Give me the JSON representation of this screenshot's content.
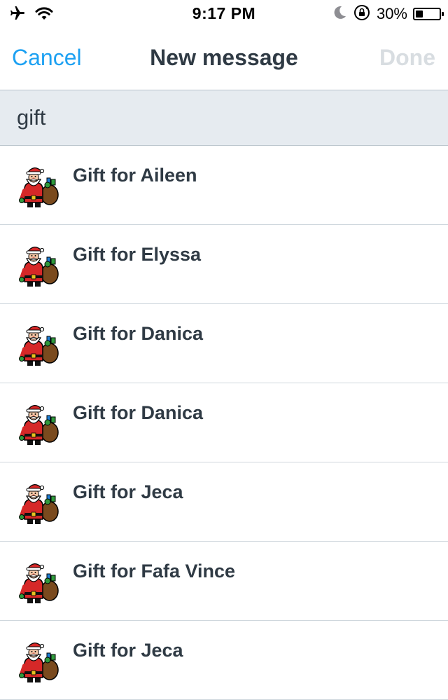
{
  "status_bar": {
    "time": "9:17 PM",
    "battery_percent": "30%",
    "battery_level": 0.3
  },
  "nav": {
    "cancel_label": "Cancel",
    "title": "New message",
    "done_label": "Done"
  },
  "search": {
    "value": "gift"
  },
  "results": [
    {
      "label": "Gift for Aileen",
      "icon": "santa-icon"
    },
    {
      "label": "Gift for Elyssa",
      "icon": "santa-icon"
    },
    {
      "label": "Gift for Danica",
      "icon": "santa-icon"
    },
    {
      "label": "Gift for Danica",
      "icon": "santa-icon"
    },
    {
      "label": "Gift for Jeca",
      "icon": "santa-icon"
    },
    {
      "label": "Gift for Fafa Vince",
      "icon": "santa-icon"
    },
    {
      "label": "Gift for Jeca",
      "icon": "santa-icon"
    }
  ],
  "colors": {
    "accent": "#1da1f2",
    "disabled": "#d8dde1",
    "search_bg": "#e6ebf0",
    "text": "#2f3a44"
  }
}
